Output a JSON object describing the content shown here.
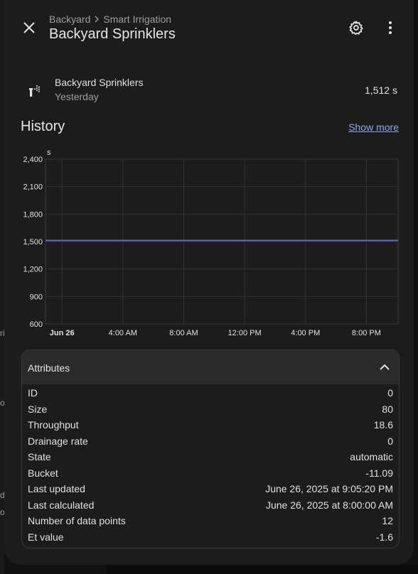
{
  "header": {
    "breadcrumb": [
      "Backyard",
      "Smart Irrigation"
    ],
    "title": "Backyard Sprinklers"
  },
  "state": {
    "name": "Backyard Sprinklers",
    "time": "Yesterday",
    "value": "1,512 s",
    "icon": "sprinkler-icon"
  },
  "history": {
    "title": "History",
    "show_more": "Show more"
  },
  "chart_data": {
    "type": "line",
    "ylabel": "s",
    "ylim": [
      600,
      2400
    ],
    "y_ticks": [
      "2,400",
      "2,100",
      "1,800",
      "1,500",
      "1,200",
      "900",
      "600"
    ],
    "x_ticks": [
      "Jun 26",
      "4:00 AM",
      "8:00 AM",
      "12:00 PM",
      "4:00 PM",
      "8:00 PM"
    ],
    "x_range": [
      "Jun 25 10:55 PM",
      "Jun 26 10:05 PM"
    ],
    "series": [
      {
        "color": "#5c6bc0",
        "x": [
          "Jun 25 10:55 PM",
          "Jun 26 10:05 PM"
        ],
        "values": [
          1512,
          1512
        ]
      }
    ],
    "grid": true
  },
  "attributes": {
    "title": "Attributes",
    "rows": [
      {
        "key": "ID",
        "value": "0"
      },
      {
        "key": "Size",
        "value": "80"
      },
      {
        "key": "Throughput",
        "value": "18.6"
      },
      {
        "key": "Drainage rate",
        "value": "0"
      },
      {
        "key": "State",
        "value": "automatic"
      },
      {
        "key": "Bucket",
        "value": "-11.09"
      },
      {
        "key": "Last updated",
        "value": "June 26, 2025 at 9:05:20 PM"
      },
      {
        "key": "Last calculated",
        "value": "June 26, 2025 at 8:00:00 AM"
      },
      {
        "key": "Number of data points",
        "value": "12"
      },
      {
        "key": "Et value",
        "value": "-1.6"
      }
    ]
  },
  "background_fragments": [
    "ri",
    "or",
    "d",
    "o"
  ],
  "colors": {
    "link": "#90a8e8",
    "series": "#5c6bc0",
    "surface": "#1c1c1c"
  }
}
